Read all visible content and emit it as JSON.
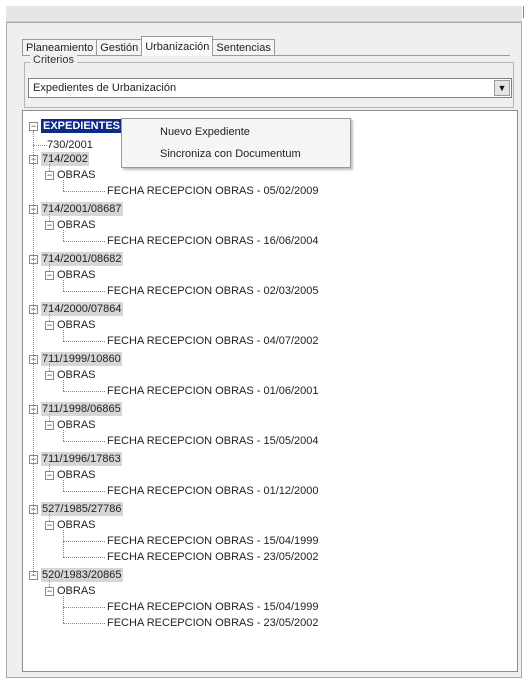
{
  "tabs": [
    {
      "label": "Planeamiento",
      "active": false
    },
    {
      "label": "Gestión",
      "active": false
    },
    {
      "label": "Urbanización",
      "active": true
    },
    {
      "label": "Sentencias",
      "active": false
    }
  ],
  "criteria": {
    "legend": "Criterios",
    "selected": "Expedientes de Urbanización"
  },
  "tree": {
    "root": "EXPEDIENTES",
    "first_item": "730/2001",
    "expedientes": [
      {
        "id": "714/2002",
        "group": "OBRAS",
        "dates": [
          "FECHA RECEPCION OBRAS - 05/02/2009"
        ]
      },
      {
        "id": "714/2001/08687",
        "group": "OBRAS",
        "dates": [
          "FECHA RECEPCION OBRAS - 16/06/2004"
        ]
      },
      {
        "id": "714/2001/08682",
        "group": "OBRAS",
        "dates": [
          "FECHA RECEPCION OBRAS - 02/03/2005"
        ]
      },
      {
        "id": "714/2000/07864",
        "group": "OBRAS",
        "dates": [
          "FECHA RECEPCION OBRAS - 04/07/2002"
        ]
      },
      {
        "id": "711/1999/10860",
        "group": "OBRAS",
        "dates": [
          "FECHA RECEPCION OBRAS - 01/06/2001"
        ]
      },
      {
        "id": "711/1998/06865",
        "group": "OBRAS",
        "dates": [
          "FECHA RECEPCION OBRAS - 15/05/2004"
        ]
      },
      {
        "id": "711/1996/17863",
        "group": "OBRAS",
        "dates": [
          "FECHA RECEPCION OBRAS - 01/12/2000"
        ]
      },
      {
        "id": "527/1985/27786",
        "group": "OBRAS",
        "dates": [
          "FECHA RECEPCION OBRAS - 15/04/1999",
          "FECHA RECEPCION OBRAS - 23/05/2002"
        ]
      },
      {
        "id": "520/1983/20865",
        "group": "OBRAS",
        "dates": [
          "FECHA RECEPCION OBRAS - 15/04/1999",
          "FECHA RECEPCION OBRAS - 23/05/2002"
        ]
      }
    ]
  },
  "context_menu": {
    "items": [
      "Nuevo Expediente",
      "Sincroniza con Documentum"
    ]
  },
  "icons": {
    "expand_collapse": "minus-box-icon",
    "dropdown": "chevron-down-icon"
  },
  "colors": {
    "selection": "#0b2a8a",
    "highlight": "#d6d6d6"
  }
}
